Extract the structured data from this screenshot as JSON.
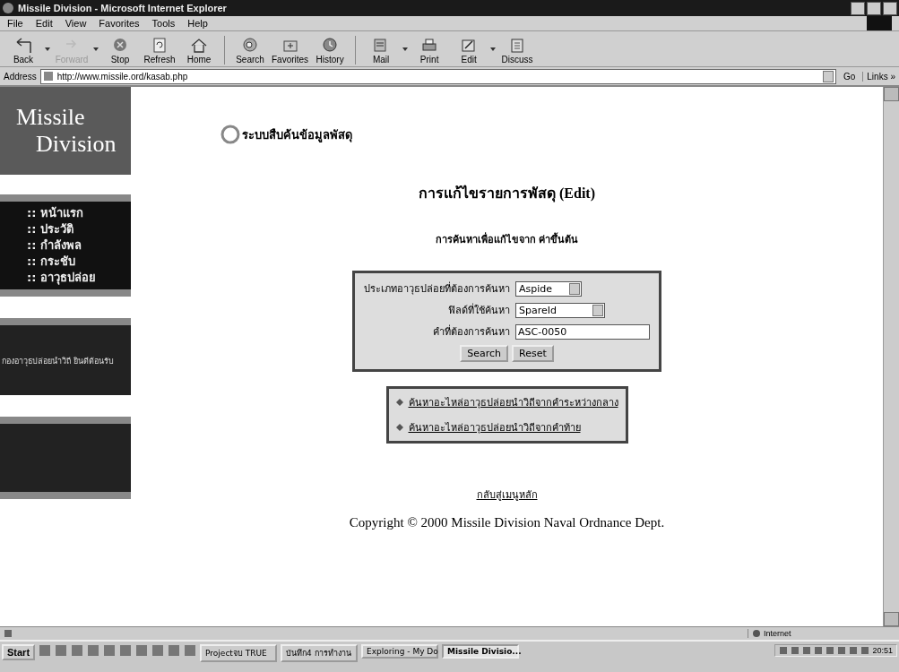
{
  "window": {
    "title": "Missile Division - Microsoft Internet Explorer"
  },
  "menu": [
    "File",
    "Edit",
    "View",
    "Favorites",
    "Tools",
    "Help"
  ],
  "toolbar": [
    {
      "label": "Back",
      "disabled": false,
      "dropdown": true
    },
    {
      "label": "Forward",
      "disabled": true,
      "dropdown": true
    },
    {
      "label": "Stop",
      "disabled": false,
      "dropdown": false
    },
    {
      "label": "Refresh",
      "disabled": false,
      "dropdown": false
    },
    {
      "label": "Home",
      "disabled": false,
      "dropdown": false
    },
    {
      "label": "Search",
      "disabled": false,
      "dropdown": false
    },
    {
      "label": "Favorites",
      "disabled": false,
      "dropdown": false
    },
    {
      "label": "History",
      "disabled": false,
      "dropdown": false
    },
    {
      "label": "Mail",
      "disabled": false,
      "dropdown": true
    },
    {
      "label": "Print",
      "disabled": false,
      "dropdown": false
    },
    {
      "label": "Edit",
      "disabled": false,
      "dropdown": true
    },
    {
      "label": "Discuss",
      "disabled": false,
      "dropdown": false
    }
  ],
  "address_bar": {
    "label": "Address",
    "url": "http://www.missile.ord/kasab.php",
    "go": "Go",
    "links": "Links »"
  },
  "site": {
    "logo_line_1": "Missile",
    "logo_line_2": "Division",
    "nav": [
      ":: หน้าแรก",
      ":: ประวัติ",
      ":: กำลังพล",
      ":: กระชับ",
      ":: อาวุธปล่อย"
    ],
    "notice": "กองอาวุธปล่อยนำวิถี ยินดีต้อนรับ",
    "heading": "ระบบสืบค้นข้อมูลพัสดุ",
    "title": "การแก้ไขรายการพัสดุ (Edit)",
    "subtitle": "การค้นหาเพื่อแก้ไขจาก ค่าขึ้นต้น",
    "form": [
      {
        "kind": "select",
        "label": "ประเภทอาวุธปล่อยที่ต้องการค้นหา",
        "value": "Aspide"
      },
      {
        "kind": "select",
        "label": "ฟิลด์ที่ใช้ค้นหา",
        "value": "SpareId"
      },
      {
        "kind": "text",
        "label": "คำที่ต้องการค้นหา",
        "value": "ASC-0050"
      }
    ],
    "buttons": [
      "Search",
      "Reset"
    ],
    "links": [
      "ค้นหาอะไหล่อาวุธปล่อยนำวิถีจากคำระหว่างกลาง",
      "ค้นหาอะไหล่อาวุธปล่อยนำวิถีจากคำท้าย"
    ],
    "back_link": "กลับสู่เมนูหลัก",
    "copyright": "Copyright © 2000 Missile Division Naval Ordnance Dept."
  },
  "status_bar": {
    "zone": "Internet"
  },
  "taskbar": {
    "start": "Start",
    "tasks": [
      {
        "label": "Projectจบ TRUE",
        "selected": false
      },
      {
        "label": "บันทึก4 การทำงาน",
        "selected": false
      },
      {
        "label": "Exploring - My Do",
        "selected": false
      },
      {
        "label": "Missile Divisio...",
        "selected": true
      }
    ],
    "clock": "20:51"
  }
}
